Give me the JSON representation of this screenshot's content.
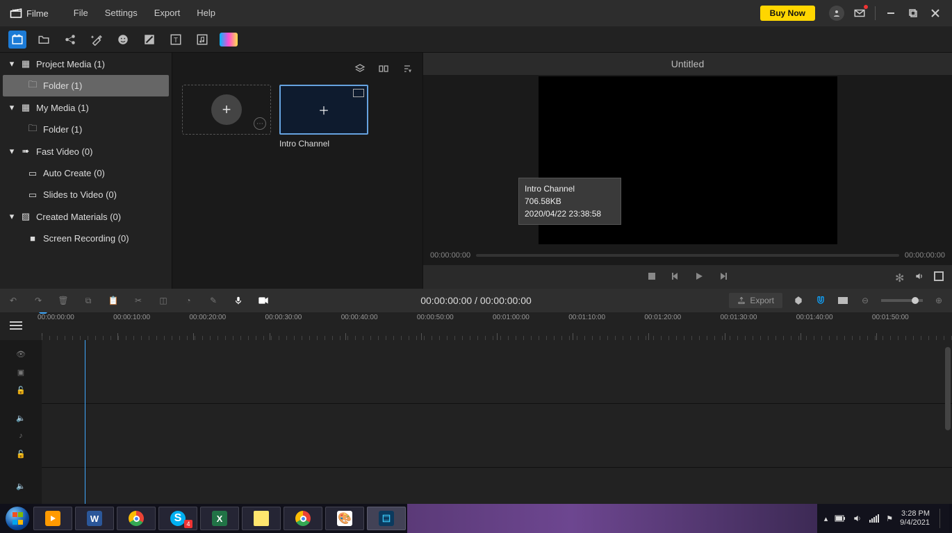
{
  "app": {
    "name": "Filme"
  },
  "menu": [
    "File",
    "Settings",
    "Export",
    "Help"
  ],
  "title_actions": {
    "buy": "Buy Now"
  },
  "sidebar": {
    "groups": [
      {
        "label": "Project Media (1)",
        "children": [
          {
            "label": "Folder (1)",
            "selected": true
          }
        ]
      },
      {
        "label": "My Media (1)",
        "children": [
          {
            "label": "Folder (1)"
          }
        ]
      },
      {
        "label": "Fast Video (0)",
        "children": [
          {
            "label": "Auto Create (0)"
          },
          {
            "label": "Slides to Video (0)"
          }
        ]
      },
      {
        "label": "Created Materials (0)",
        "children": [
          {
            "label": "Screen Recording (0)"
          }
        ]
      }
    ]
  },
  "media": {
    "clip_name": "Intro Channel"
  },
  "tooltip": {
    "name": "Intro Channel",
    "size": "706.58KB",
    "date": "2020/04/22 23:38:58"
  },
  "preview": {
    "title": "Untitled",
    "time_left": "00:00:00:00",
    "time_right": "00:00:00:00"
  },
  "toolbar": {
    "time_current": "00:00:00:00",
    "time_total": "00:00:00:00",
    "export": "Export"
  },
  "ruler": [
    "00:00:00:00",
    "00:00:10:00",
    "00:00:20:00",
    "00:00:30:00",
    "00:00:40:00",
    "00:00:50:00",
    "00:01:00:00",
    "00:01:10:00",
    "00:01:20:00",
    "00:01:30:00",
    "00:01:40:00",
    "00:01:50:00"
  ],
  "taskbar": {
    "skype_badge": "4",
    "tray_time": "3:28 PM",
    "tray_date": "9/4/2021"
  }
}
